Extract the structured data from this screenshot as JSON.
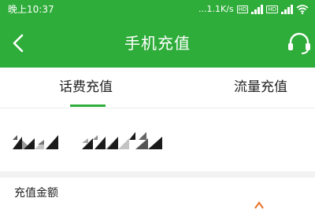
{
  "status_bar": {
    "time": "晚上10:37",
    "speed": "...1.1K/s",
    "hd_badge": "HD",
    "hd_badge2": "HD",
    "icons": [
      "signal-icon",
      "signal-icon",
      "wifi-icon",
      "battery-icon"
    ]
  },
  "nav": {
    "title": "手机充值",
    "back_icon": "chevron-left-icon",
    "service_icon": "headset-icon"
  },
  "tabs": [
    {
      "label": "话费充值",
      "active": true
    },
    {
      "label": "流量充值",
      "active": false
    }
  ],
  "amount": {
    "label": "充值金额"
  },
  "colors": {
    "primary": "#2fad3a",
    "background": "#ffffff",
    "divider": "#f2f2f2"
  }
}
